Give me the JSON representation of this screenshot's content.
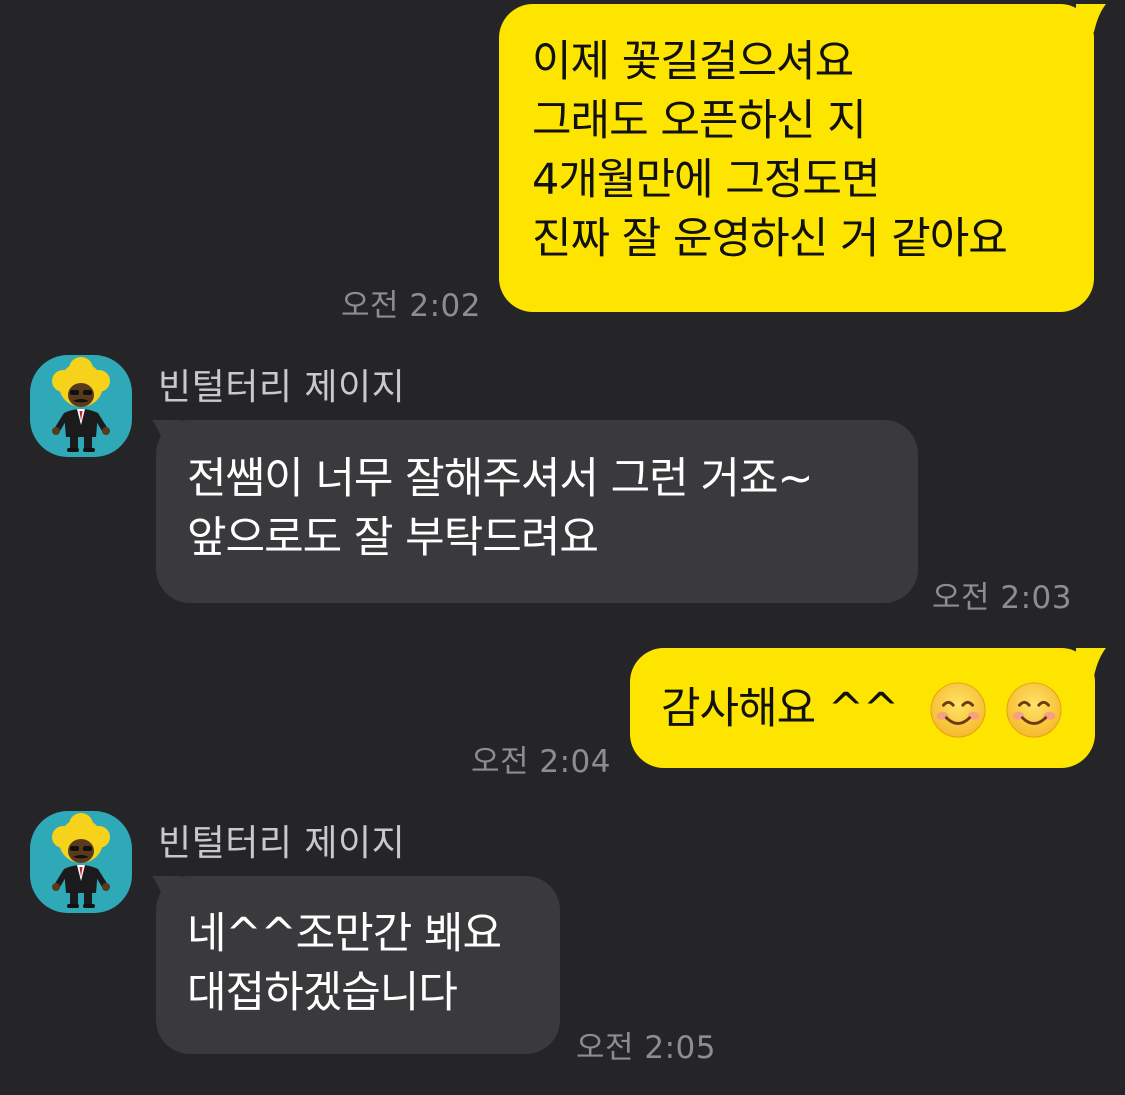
{
  "colors": {
    "background": "#252528",
    "my_bubble": "#FEE500",
    "their_bubble": "#3A3A3D",
    "timestamp": "#8D8D90",
    "sender_name": "#C9C9CC",
    "avatar_bg": "#2FA9B8"
  },
  "messages": [
    {
      "from": "me",
      "lines": [
        "이제 꽃길걸으셔요",
        "그래도 오픈하신 지",
        "4개월만에 그정도면",
        "진짜 잘 운영하신 거 같아요"
      ],
      "time": "오전 2:02"
    },
    {
      "from": "them",
      "sender": "빈털터리 제이지",
      "avatar_icon": "jay-g-character-icon",
      "lines": [
        "전쌤이 너무 잘해주셔서 그런 거죠~",
        "앞으로도 잘 부탁드려요"
      ],
      "time": "오전 2:03"
    },
    {
      "from": "me",
      "text": "감사해요 ^^",
      "emojis": [
        "smiling-face-emoji",
        "smiling-face-emoji"
      ],
      "time": "오전 2:04"
    },
    {
      "from": "them",
      "sender": "빈털터리 제이지",
      "avatar_icon": "jay-g-character-icon",
      "lines": [
        "네^^조만간 봬요",
        "대접하겠습니다"
      ],
      "time": "오전 2:05"
    }
  ]
}
